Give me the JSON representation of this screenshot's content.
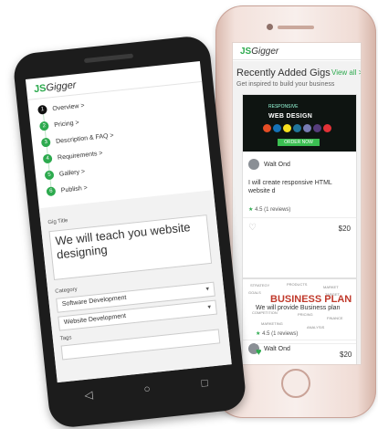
{
  "iphone": {
    "logo_prefix": "JS",
    "logo_suffix": "Gigger",
    "section_title": "Recently Added Gigs",
    "section_subtitle": "Get inspired to build your business",
    "view_all": "View all >",
    "cards": [
      {
        "banner_title": "WEB DESIGN",
        "banner_subtitle": "RESPONSIVE",
        "banner_button": "ORDER NOW",
        "seller": "Walt Ond",
        "title": "I will create responsive HTML website d",
        "rating": "4.5",
        "reviews": "(1 reviews)",
        "price": "$20"
      },
      {
        "banner_title": "BUSINESS PLAN",
        "seller": "Walt Ond",
        "title": "We will provide Business plan",
        "rating": "4.5",
        "reviews": "(1 reviews)",
        "price": "$20"
      }
    ]
  },
  "android": {
    "logo_prefix": "JS",
    "logo_suffix": "Gigger",
    "steps": [
      {
        "num": "1",
        "label": "Overview >"
      },
      {
        "num": "2",
        "label": "Pricing >"
      },
      {
        "num": "3",
        "label": "Description & FAQ >"
      },
      {
        "num": "4",
        "label": "Requirements >"
      },
      {
        "num": "5",
        "label": "Gallery >"
      },
      {
        "num": "6",
        "label": "Publish >"
      }
    ],
    "gig_title_label": "Gig Title",
    "gig_title_value": "We will teach you website designing",
    "category_label": "Category",
    "category_value": "Software Development",
    "subcategory_value": "Website Development",
    "tags_label": "Tags"
  },
  "colors": {
    "brand_green": "#2daa4e",
    "phone_dark": "#1c1c1c",
    "rose_gold": "#f3e2dc"
  },
  "icons": [
    "back-icon",
    "home-icon",
    "recents-icon",
    "heart-icon",
    "star-icon",
    "chevron-down-icon"
  ]
}
